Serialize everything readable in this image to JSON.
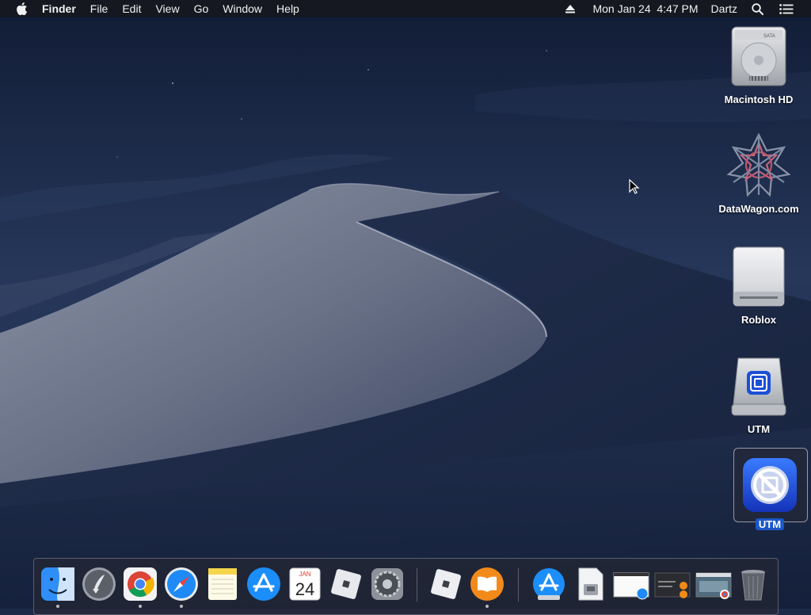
{
  "menubar": {
    "app_name": "Finder",
    "menus": [
      "File",
      "Edit",
      "View",
      "Go",
      "Window",
      "Help"
    ],
    "datetime": "Mon Jan 24  4:47 PM",
    "user": "Dartz",
    "icons": [
      "apple-icon",
      "eject-icon",
      "spotlight-search-icon",
      "notification-center-icon"
    ]
  },
  "desktop": {
    "icons": [
      {
        "label": "Macintosh HD",
        "icon": "internal-disk-icon"
      },
      {
        "label": "DataWagon.com",
        "icon": "datawagon-icon"
      },
      {
        "label": "Roblox",
        "icon": "removable-disk-icon"
      },
      {
        "label": "UTM",
        "icon": "utm-disk-icon"
      },
      {
        "label": "UTM",
        "icon": "utm-app-icon",
        "selected": true
      }
    ]
  },
  "dock": {
    "items": [
      {
        "name": "Finder",
        "icon": "finder-icon",
        "running": true
      },
      {
        "name": "Launchpad",
        "icon": "launchpad-icon",
        "running": false
      },
      {
        "name": "Google Chrome",
        "icon": "chrome-icon",
        "running": true
      },
      {
        "name": "Safari",
        "icon": "safari-icon",
        "running": true
      },
      {
        "name": "Notes",
        "icon": "notes-icon",
        "running": false
      },
      {
        "name": "App Store",
        "icon": "app-store-icon",
        "running": false
      },
      {
        "name": "Calendar",
        "icon": "calendar-icon",
        "running": false,
        "month": "JAN",
        "day": "24"
      },
      {
        "name": "Roblox",
        "icon": "roblox-icon",
        "running": false
      },
      {
        "name": "System Preferences",
        "icon": "system-preferences-icon",
        "running": false
      },
      {
        "name": "Roblox Studio",
        "icon": "roblox-icon",
        "running": false
      },
      {
        "name": "Books",
        "icon": "books-icon",
        "running": true
      },
      {
        "name": "App Store Downloads",
        "icon": "app-store-folder-icon",
        "running": false
      },
      {
        "name": "Document",
        "icon": "document-icon",
        "running": false
      },
      {
        "name": "Window Preview",
        "icon": "window-preview-icon",
        "running": false
      },
      {
        "name": "Window Preview 2",
        "icon": "window-preview-icon",
        "running": false
      },
      {
        "name": "Window Preview 3",
        "icon": "window-preview-icon",
        "running": false
      },
      {
        "name": "Trash",
        "icon": "trash-icon",
        "running": false
      }
    ]
  },
  "colors": {
    "accent": "#1b57c8",
    "menubar_bg": "#16181e",
    "sky_top": "#13203c",
    "sky_bottom": "#2c3d5c"
  }
}
